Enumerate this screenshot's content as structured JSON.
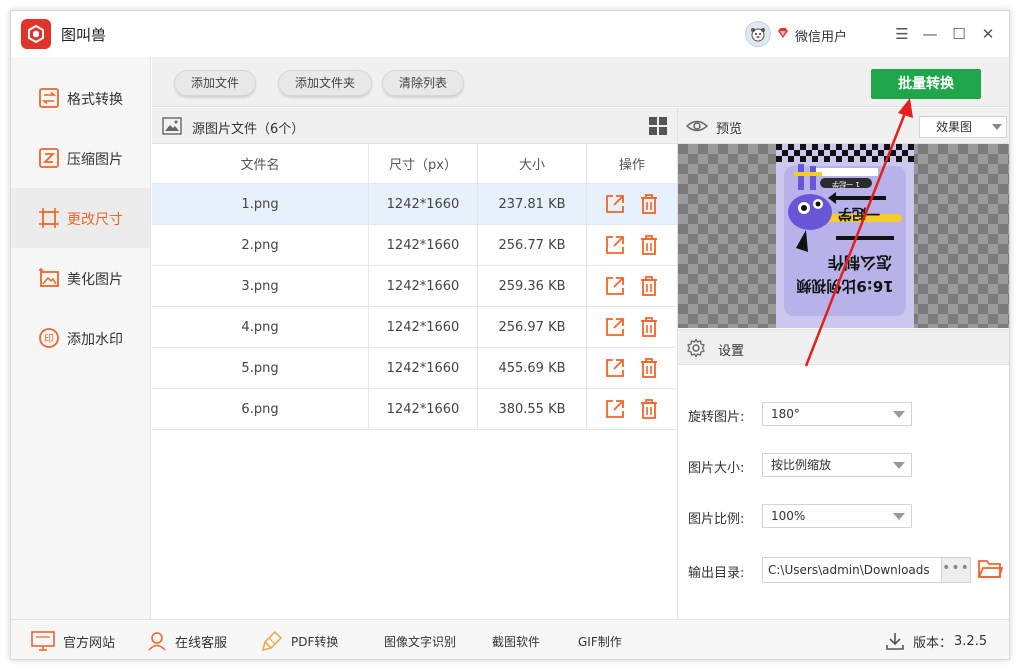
{
  "app": {
    "title": "图叫兽"
  },
  "user": {
    "name": "微信用户"
  },
  "window_controls": {
    "menu": "☰",
    "minimize": "—",
    "maximize": "☐",
    "close": "✕"
  },
  "sidebar": {
    "items": [
      {
        "label": "格式转换",
        "icon": "format-convert-icon"
      },
      {
        "label": "压缩图片",
        "icon": "compress-icon"
      },
      {
        "label": "更改尺寸",
        "icon": "resize-icon",
        "active": true
      },
      {
        "label": "美化图片",
        "icon": "beautify-icon"
      },
      {
        "label": "添加水印",
        "icon": "watermark-icon"
      }
    ]
  },
  "toolbar": {
    "add_file": "添加文件",
    "add_folder": "添加文件夹",
    "clear_list": "清除列表",
    "batch_convert": "批量转换"
  },
  "files": {
    "header": "源图片文件（6个）",
    "columns": [
      "文件名",
      "尺寸（px）",
      "大小",
      "操作"
    ],
    "rows": [
      {
        "name": "1.png",
        "size_px": "1242*1660",
        "filesize": "237.81 KB",
        "selected": true
      },
      {
        "name": "2.png",
        "size_px": "1242*1660",
        "filesize": "256.77 KB"
      },
      {
        "name": "3.png",
        "size_px": "1242*1660",
        "filesize": "259.36 KB"
      },
      {
        "name": "4.png",
        "size_px": "1242*1660",
        "filesize": "256.97 KB"
      },
      {
        "name": "5.png",
        "size_px": "1242*1660",
        "filesize": "455.69 KB"
      },
      {
        "name": "6.png",
        "size_px": "1242*1660",
        "filesize": "380.55 KB"
      }
    ]
  },
  "preview": {
    "title": "预览",
    "mode": "效果图",
    "poster_lines": [
      "16:9比例视频",
      "怎么制作",
      "一起学",
      "1 一起学"
    ]
  },
  "settings": {
    "title": "设置",
    "rotate": {
      "label": "旋转图片:",
      "value": "180°"
    },
    "size": {
      "label": "图片大小:",
      "value": "按比例缩放"
    },
    "ratio": {
      "label": "图片比例:",
      "value": "100%"
    },
    "output": {
      "label": "输出目录:",
      "value": "C:\\Users\\admin\\Downloads",
      "more": "•••"
    }
  },
  "footer": {
    "website": "官方网站",
    "support": "在线客服",
    "pdf": "PDF转换",
    "ocr": "图像文字识别",
    "screenshot": "截图软件",
    "gif": "GIF制作",
    "version_label": "版本：",
    "version": "3.2.5"
  },
  "colors": {
    "accent": "#f0652a",
    "primary_green": "#1fa64b",
    "annotation_red": "#e5201b",
    "selected_row": "#e6f1fb"
  }
}
